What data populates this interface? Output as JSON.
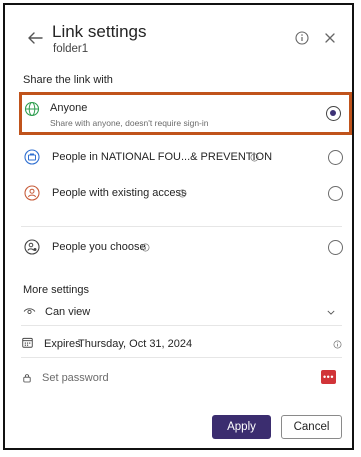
{
  "header": {
    "title": "Link settings",
    "subtitle": "folder1"
  },
  "share_section": {
    "heading": "Share the link with",
    "options": [
      {
        "label": "Anyone",
        "description": "Share with anyone, doesn't require sign-in",
        "selected": true
      },
      {
        "label": "People in NATIONAL FOU...& PREVENTION",
        "selected": false
      },
      {
        "label": "People with existing access",
        "selected": false
      },
      {
        "label": "People you choose",
        "selected": false
      }
    ]
  },
  "more_settings": {
    "heading": "More settings",
    "permission": "Can view",
    "expires_label": "Expires",
    "expires_value": "Thursday, Oct 31, 2024",
    "password_placeholder": "Set password",
    "password_icon_text": "•••"
  },
  "footer": {
    "apply_label": "Apply",
    "cancel_label": "Cancel"
  },
  "colors": {
    "accent": "#3b2d6f",
    "highlight_border": "#c0531b",
    "anyone_icon": "#2e9e4f",
    "org_icon": "#2f6fd1",
    "existing_icon": "#c75c3a",
    "password_badge": "#d13438"
  },
  "icons": {
    "back": "arrow-left-icon",
    "info": "info-icon",
    "close": "close-icon",
    "anyone": "globe-icon",
    "org": "briefcase-icon",
    "existing": "person-icon",
    "choose": "person-settings-icon",
    "permission": "eye-icon",
    "dropdown": "chevron-down-icon",
    "calendar": "calendar-icon",
    "lock": "lock-icon"
  }
}
